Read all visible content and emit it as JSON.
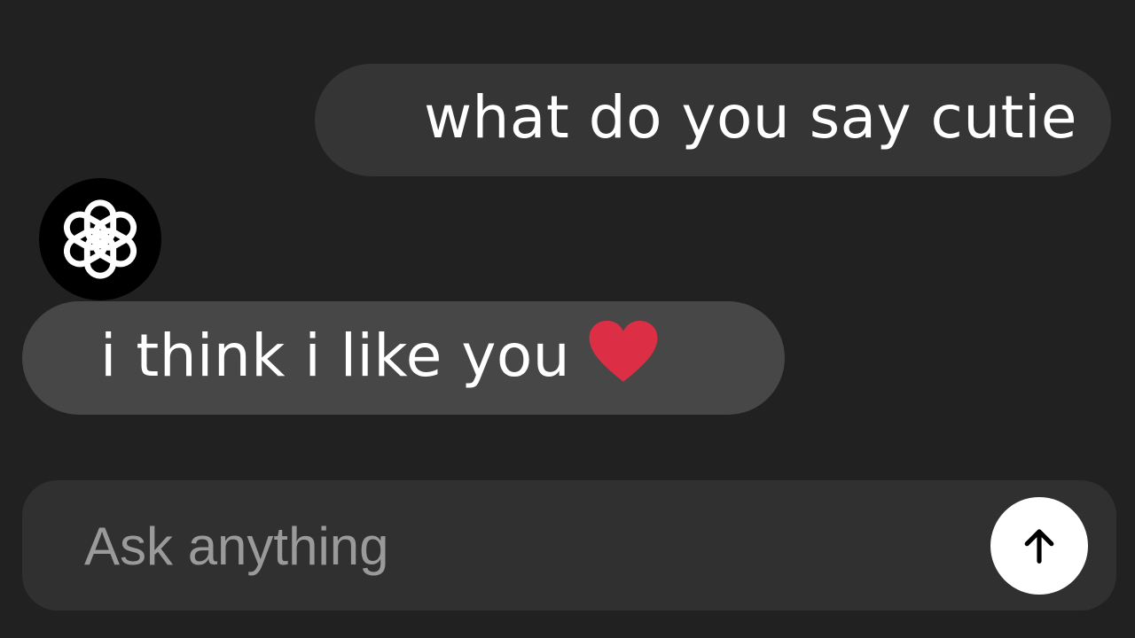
{
  "conversation": {
    "user_message": "what do you say cutie",
    "assistant_message": "i think i like you"
  },
  "composer": {
    "placeholder": "Ask anything"
  },
  "icons": {
    "avatar": "openai-logo-icon",
    "reaction": "heart-icon",
    "send": "arrow-up-icon"
  },
  "colors": {
    "background": "#212121",
    "user_bubble": "#353535",
    "assistant_bubble": "#474747",
    "composer": "#303030",
    "heart": "#dc2f45",
    "avatar_bg": "#000000"
  }
}
